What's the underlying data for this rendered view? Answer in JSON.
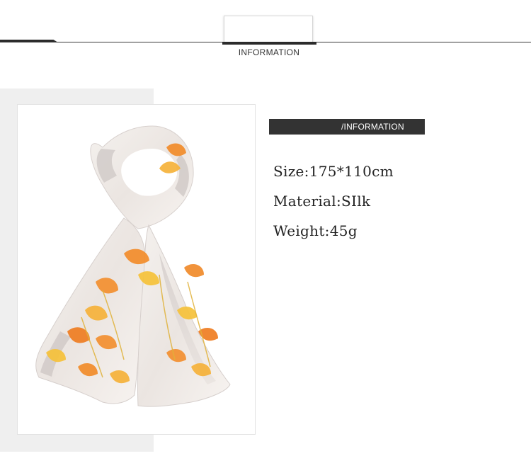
{
  "header": {
    "title": "INFORMATION"
  },
  "info_panel": {
    "bar_label": "/INFORMATION",
    "specs": [
      {
        "key": "size",
        "text": "Size:175*110cm"
      },
      {
        "key": "material",
        "text": "Material:SIlk"
      },
      {
        "key": "weight",
        "text": "Weight:45g"
      }
    ]
  },
  "product_image": {
    "subject": "silk-scarf",
    "palette": {
      "base": "#eeeae6",
      "grey": "#c9c2c0",
      "orange": "#f08a2a",
      "yellow": "#f6c23a"
    }
  }
}
